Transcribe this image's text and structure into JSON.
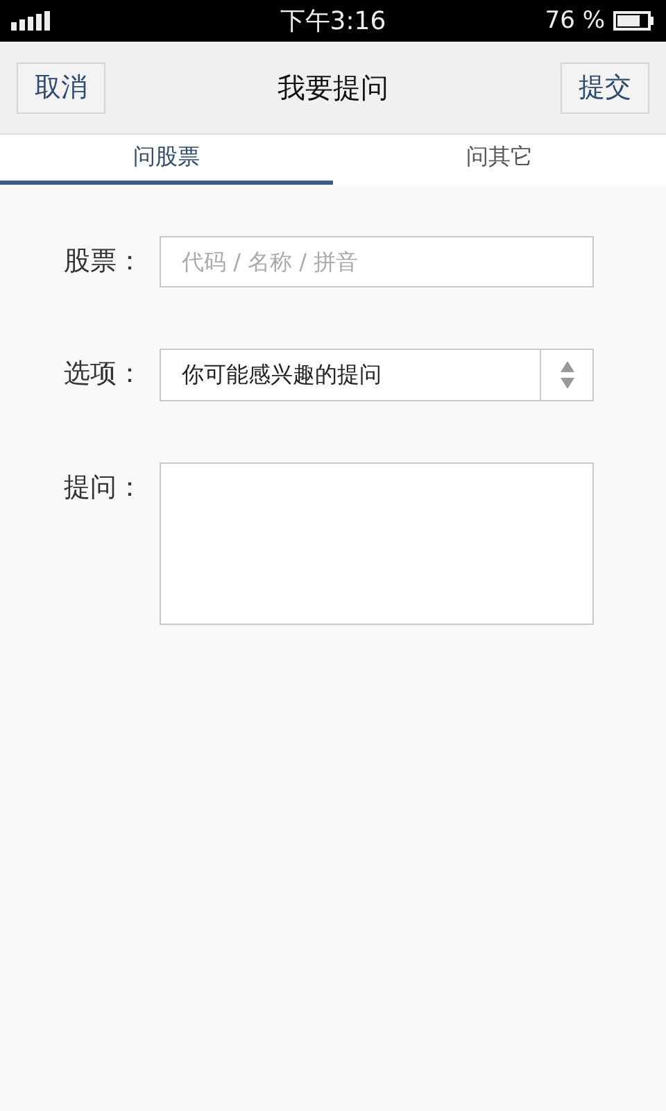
{
  "status_bar": {
    "time": "下午3:16",
    "battery": "76 %"
  },
  "nav": {
    "title": "我要提问",
    "left_button": "取消",
    "right_button": "提交"
  },
  "tabs": [
    {
      "label": "问股票",
      "selected": true
    },
    {
      "label": "问其它",
      "selected": false
    }
  ],
  "form": [
    {
      "kind": "text",
      "label": "股票：",
      "placeholder": "代码 / 名称 / 拼音"
    },
    {
      "kind": "select",
      "label": "选项：",
      "value": "你可能感兴趣的提问"
    },
    {
      "kind": "textarea",
      "label": "提问："
    }
  ]
}
